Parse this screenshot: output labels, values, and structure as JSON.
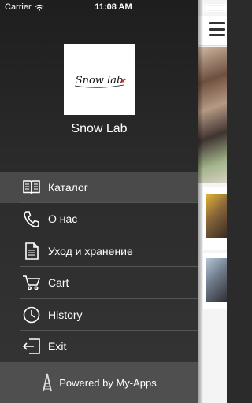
{
  "status_bar": {
    "carrier": "Carrier",
    "time": "11:08 AM"
  },
  "app": {
    "logo_text": "Snow lab",
    "name": "Snow Lab"
  },
  "menu": {
    "items": [
      {
        "label": "Каталог",
        "icon": "book-icon",
        "active": true
      },
      {
        "label": "О нас",
        "icon": "phone-icon",
        "active": false
      },
      {
        "label": "Уход и хранение",
        "icon": "document-icon",
        "active": false
      },
      {
        "label": "Cart",
        "icon": "cart-icon",
        "active": false
      },
      {
        "label": "History",
        "icon": "clock-icon",
        "active": false
      },
      {
        "label": "Exit",
        "icon": "exit-icon",
        "active": false
      }
    ]
  },
  "footer": {
    "powered_label": "Powered by My-Apps"
  },
  "colors": {
    "drawer_bg": "#2c2c2c",
    "active_item": "#4a4a4a",
    "footer_bg": "#4f4f4f",
    "text": "#ffffff"
  }
}
